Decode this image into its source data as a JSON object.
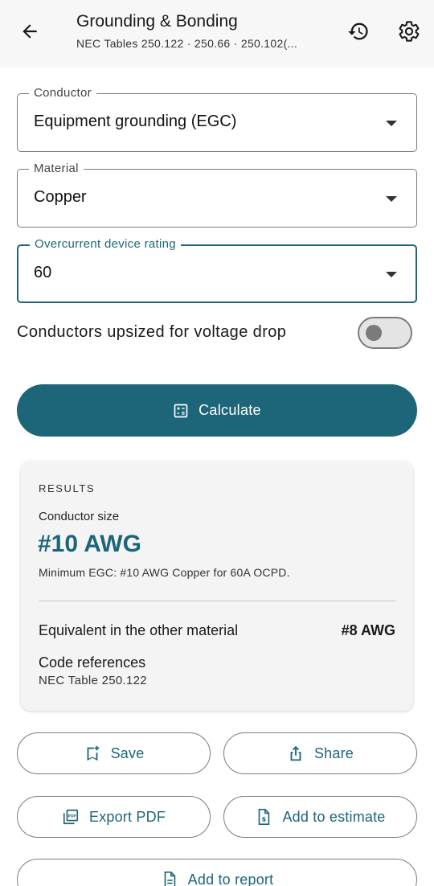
{
  "header": {
    "title": "Grounding & Bonding",
    "subtitle": "NEC Tables 250.122 · 250.66 · 250.102(...",
    "icons": [
      "arrow-back-icon",
      "history-icon",
      "gear-icon"
    ]
  },
  "form": {
    "conductor": {
      "label": "Conductor",
      "value": "Equipment grounding (EGC)"
    },
    "material": {
      "label": "Material",
      "value": "Copper"
    },
    "ocpd": {
      "label": "Overcurrent device rating",
      "value": "60"
    },
    "upsized": {
      "label": "Conductors upsized for voltage drop",
      "on": false
    }
  },
  "calculate_label": "Calculate",
  "results": {
    "heading": "RESULTS",
    "size_label": "Conductor size",
    "size_value": "#10 AWG",
    "note": "Minimum EGC: #10 AWG Copper for 60A OCPD.",
    "equiv_label": "Equivalent in the other material",
    "equiv_value": "#8 AWG",
    "code_label": "Code references",
    "code_value": "NEC Table 250.122"
  },
  "actions": {
    "save": "Save",
    "share": "Share",
    "export_pdf": "Export PDF",
    "add_estimate": "Add to estimate",
    "add_report": "Add to report"
  },
  "colors": {
    "accent": "#1d6579",
    "appbar_bg": "#f7f7f7",
    "card_bg": "#f4f4f4"
  }
}
